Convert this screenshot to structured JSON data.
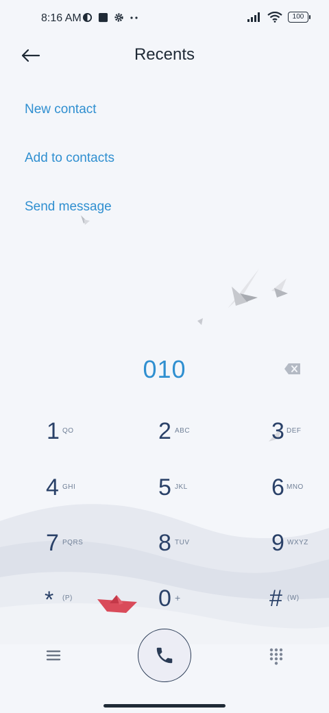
{
  "status": {
    "time": "8:16 AM",
    "battery": "100"
  },
  "header": {
    "title": "Recents"
  },
  "actions": {
    "new_contact": "New contact",
    "add_to_contacts": "Add to contacts",
    "send_message": "Send message"
  },
  "dialer": {
    "number": "010"
  },
  "keypad": {
    "k1": {
      "digit": "1",
      "letters": "QO"
    },
    "k2": {
      "digit": "2",
      "letters": "ABC"
    },
    "k3": {
      "digit": "3",
      "letters": "DEF"
    },
    "k4": {
      "digit": "4",
      "letters": "GHI"
    },
    "k5": {
      "digit": "5",
      "letters": "JKL"
    },
    "k6": {
      "digit": "6",
      "letters": "MNO"
    },
    "k7": {
      "digit": "7",
      "letters": "PQRS"
    },
    "k8": {
      "digit": "8",
      "letters": "TUV"
    },
    "k9": {
      "digit": "9",
      "letters": "WXYZ"
    },
    "kstar": {
      "digit": "*",
      "letters": "(P)"
    },
    "k0": {
      "digit": "0",
      "letters": "+"
    },
    "khash": {
      "digit": "#",
      "letters": "(W)"
    }
  },
  "colors": {
    "accent": "#2f8fd0",
    "digits": "#2a4168",
    "background": "#f4f6fa"
  },
  "icons": {
    "back": "arrow-left-icon",
    "backspace": "backspace-icon",
    "menu": "hamburger-menu-icon",
    "call": "phone-icon",
    "dialpad": "dialpad-icon"
  }
}
